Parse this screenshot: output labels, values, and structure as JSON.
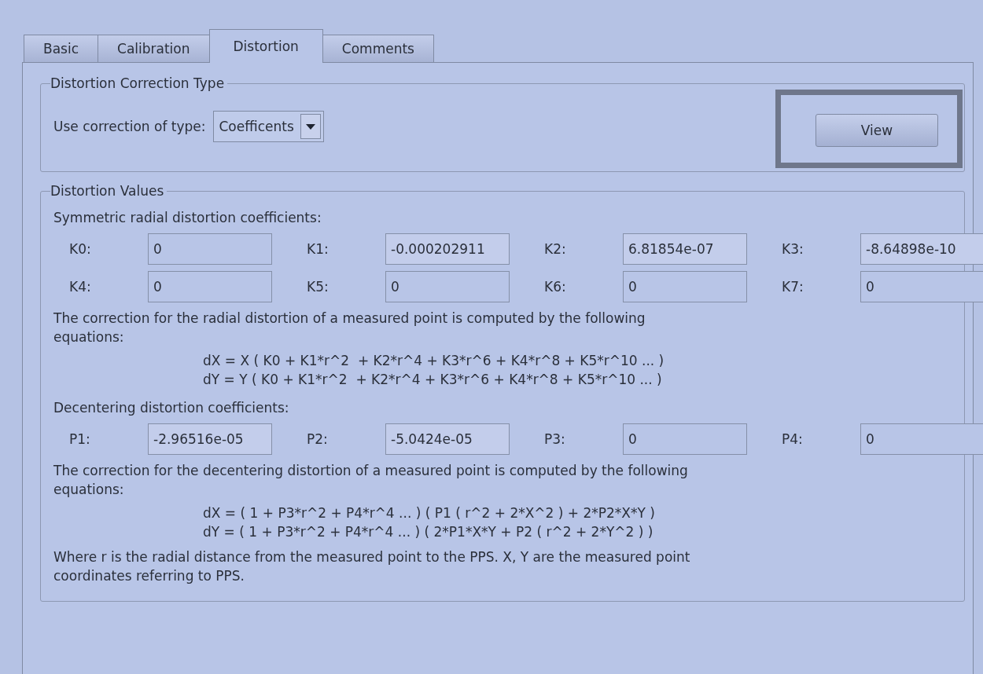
{
  "tabs": [
    {
      "label": "Basic",
      "selected": false
    },
    {
      "label": "Calibration",
      "selected": false
    },
    {
      "label": "Distortion",
      "selected": true
    },
    {
      "label": "Comments",
      "selected": false
    }
  ],
  "correction_type": {
    "title": "Distortion Correction Type",
    "label": "Use correction of type:",
    "value": "Coefficents",
    "view_button": {
      "label": "View",
      "highlighted": true
    }
  },
  "distortion_values": {
    "title": "Distortion Values",
    "radial": {
      "heading": "Symmetric radial distortion coefficients:",
      "fields": [
        {
          "label": "K0:",
          "value": "0"
        },
        {
          "label": "K1:",
          "value": "-0.000202911"
        },
        {
          "label": "K2:",
          "value": "6.81854e-07"
        },
        {
          "label": "K3:",
          "value": "-8.64898e-10"
        },
        {
          "label": "K4:",
          "value": "0"
        },
        {
          "label": "K5:",
          "value": "0"
        },
        {
          "label": "K6:",
          "value": "0"
        },
        {
          "label": "K7:",
          "value": "0"
        }
      ],
      "description": "The correction for the radial distortion of a measured point is computed by the following equations:",
      "equations": [
        "dX = X ( K0 + K1*r^2  + K2*r^4 + K3*r^6 + K4*r^8 + K5*r^10 ... )",
        "dY = Y ( K0 + K1*r^2  + K2*r^4 + K3*r^6 + K4*r^8 + K5*r^10 ... )"
      ]
    },
    "decentering": {
      "heading": "Decentering distortion coefficients:",
      "fields": [
        {
          "label": "P1:",
          "value": "-2.96516e-05"
        },
        {
          "label": "P2:",
          "value": "-5.0424e-05"
        },
        {
          "label": "P3:",
          "value": "0"
        },
        {
          "label": "P4:",
          "value": "0"
        }
      ],
      "description": "The correction for the decentering distortion of a measured point is computed by the following equations:",
      "equations": [
        "dX = ( 1 + P3*r^2 + P4*r^4 ... ) ( P1 ( r^2 + 2*X^2 ) + 2*P2*X*Y )",
        "dY = ( 1 + P3*r^2 + P4*r^4 ... ) ( 2*P1*X*Y + P2 ( r^2 + 2*Y^2 ) )"
      ]
    },
    "note": "Where r is the radial distance from the measured point to the PPS. X, Y are the measured point coordinates referring to PPS."
  }
}
